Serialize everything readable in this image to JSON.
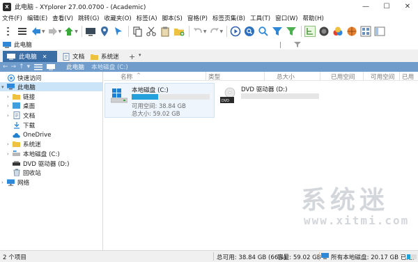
{
  "window": {
    "title": "此电脑 - XYplorer 27.00.0700 - (Academic)",
    "app_icon_text": "X",
    "controls": {
      "minimize": "—",
      "maximize": "☐",
      "close": "✕"
    }
  },
  "menu": [
    "文件(F)",
    "编辑(E)",
    "查看(V)",
    "跳转(G)",
    "收藏夹(O)",
    "标签(A)",
    "脚本(S)",
    "窗格(P)",
    "标签页集(B)",
    "工具(T)",
    "窗口(W)",
    "帮助(H)"
  ],
  "address": {
    "label": "此电脑"
  },
  "tabs": [
    {
      "label": "此电脑",
      "close": "✕",
      "active": true
    },
    {
      "label": "文档",
      "active": false
    },
    {
      "label": "系统迷",
      "active": false
    }
  ],
  "tab_add": "+",
  "tab_menu": "▾",
  "breadcrumb": {
    "back": "←",
    "forward": "→",
    "up": "↑",
    "history": "▾",
    "items": [
      "此电脑",
      "本地磁盘 (C:)"
    ]
  },
  "tree": [
    {
      "label": "快速访问",
      "expander": "",
      "icon": "star-icon"
    },
    {
      "label": "此电脑",
      "expander": "▾",
      "icon": "pc-icon",
      "selected": true
    },
    {
      "label": "链接",
      "expander": "›",
      "icon": "folder-icon"
    },
    {
      "label": "桌面",
      "expander": "›",
      "icon": "desktop-icon"
    },
    {
      "label": "文档",
      "expander": "›",
      "icon": "documents-icon"
    },
    {
      "label": "下载",
      "expander": "",
      "icon": "download-icon"
    },
    {
      "label": "OneDrive",
      "expander": "",
      "icon": "cloud-icon"
    },
    {
      "label": "系统迷",
      "expander": "›",
      "icon": "folder-icon"
    },
    {
      "label": "本地磁盘 (C:)",
      "expander": "›",
      "icon": "drive-icon"
    },
    {
      "label": "DVD 驱动器 (D:)",
      "expander": "",
      "icon": "dvd-icon"
    },
    {
      "label": "回收站",
      "expander": "",
      "icon": "recycle-bin-icon"
    },
    {
      "label": "网络",
      "expander": "›",
      "icon": "network-icon"
    }
  ],
  "columns": [
    "名称",
    "类型",
    "总大小",
    "已用空间",
    "可用空间",
    "已用"
  ],
  "sort_indicator": "^",
  "drives": [
    {
      "name": "本地磁盘 (C:)",
      "free": "可用空间: 38.84 GB",
      "total": "总大小: 59.02 GB",
      "used_fraction": 0.34,
      "selected": true
    },
    {
      "name": "DVD 驱动器 (D:)",
      "free": "",
      "total": "",
      "used_fraction": 0,
      "selected": false
    }
  ],
  "watermark": {
    "big": "系统迷",
    "small": "www.xitmi.com"
  },
  "status": {
    "items": "2 个项目",
    "free": "总可用: 38.84 GB (66%)",
    "capacity": "容量: 59.02 GB",
    "all_used": "所有本地磁盘: 20.17 GB 已用,",
    "drive_used_fraction": 0.34
  },
  "colors": {
    "accent": "#3b6ea5",
    "crumb_bar": "#6f9ccb",
    "bar_fill": "#26a0da"
  }
}
